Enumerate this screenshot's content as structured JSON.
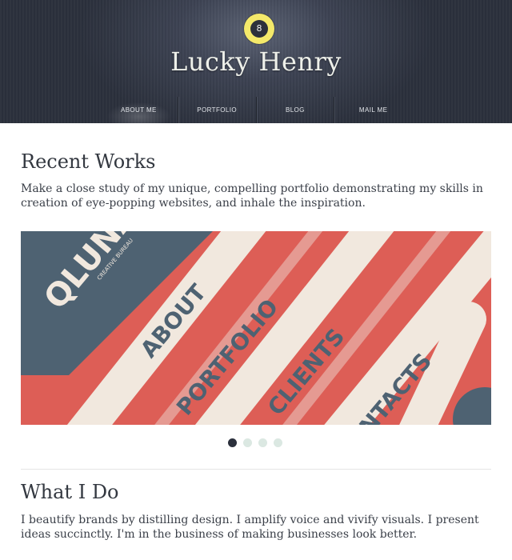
{
  "header": {
    "logo_number": "8",
    "site_title": "Lucky Henry",
    "nav": [
      {
        "label": "ABOUT ME",
        "active": true
      },
      {
        "label": "PORTFOLIO",
        "active": false
      },
      {
        "label": "BLOG",
        "active": false
      },
      {
        "label": "MAIL ME",
        "active": false
      }
    ]
  },
  "recent_works": {
    "title": "Recent Works",
    "description": "Make a close study of my unique, compelling portfolio demonstrating my skills in creation of eye-popping websites, and inhale the inspiration."
  },
  "slider": {
    "brand": "QLUNA",
    "brand_sub": "CREATIVE BUREAU",
    "menu": [
      "ABOUT",
      "PORTFOLIO",
      "CLIENTS",
      "CONTACTS"
    ],
    "slide_count": 4,
    "active_slide": 1
  },
  "what_i_do": {
    "title": "What I Do",
    "description": "I beautify brands by distilling design. I amplify voice and vivify visuals. I present ideas succinctly. I'm in the business of making businesses look better."
  },
  "colors": {
    "header_bg": "#2b303c",
    "logo_yellow": "#f4e96a",
    "slider_red": "#dd5e56",
    "slider_slate": "#4e6272",
    "slider_cream": "#f1e8de",
    "slider_pink": "#e59a92",
    "dot_inactive": "#dbe8e2",
    "dot_active": "#2b303c"
  }
}
